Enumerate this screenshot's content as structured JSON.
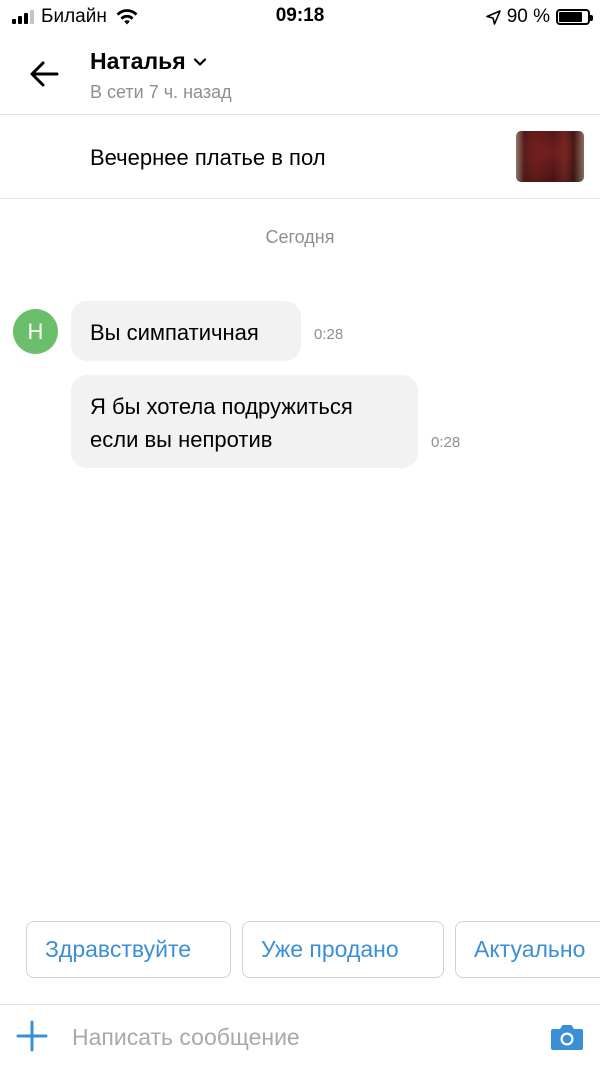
{
  "status_bar": {
    "carrier": "Билайн",
    "time": "09:18",
    "battery_percent": "90 %",
    "battery_level": 0.9,
    "icons": [
      "signal-icon",
      "wifi-icon",
      "location-arrow-icon",
      "battery-icon"
    ]
  },
  "header": {
    "back_icon": "arrow-left-icon",
    "contact_name": "Наталья",
    "dropdown_icon": "chevron-down-icon",
    "contact_status": "В сети 7 ч. назад"
  },
  "listing": {
    "title": "Вечернее платье в пол",
    "thumbnail": "dress-photo-thumbnail"
  },
  "chat": {
    "date_separator": "Сегодня",
    "avatar_initial": "Н",
    "avatar_color": "#6cbf6a",
    "messages": [
      {
        "lines": [
          "Вы симпатичная"
        ],
        "time": "0:28"
      },
      {
        "lines": [
          "Я бы хотела подружиться",
          "если вы непротив"
        ],
        "time": "0:28"
      }
    ]
  },
  "quick_replies": [
    "Здравствуйте",
    "Уже продано",
    "Актуально"
  ],
  "compose": {
    "plus_icon": "plus-icon",
    "placeholder": "Написать сообщение",
    "value": "",
    "camera_icon": "camera-icon"
  },
  "colors": {
    "accent": "#3a8fd6",
    "bubble_bg": "#f2f2f2",
    "secondary_text": "#8e8e93"
  }
}
